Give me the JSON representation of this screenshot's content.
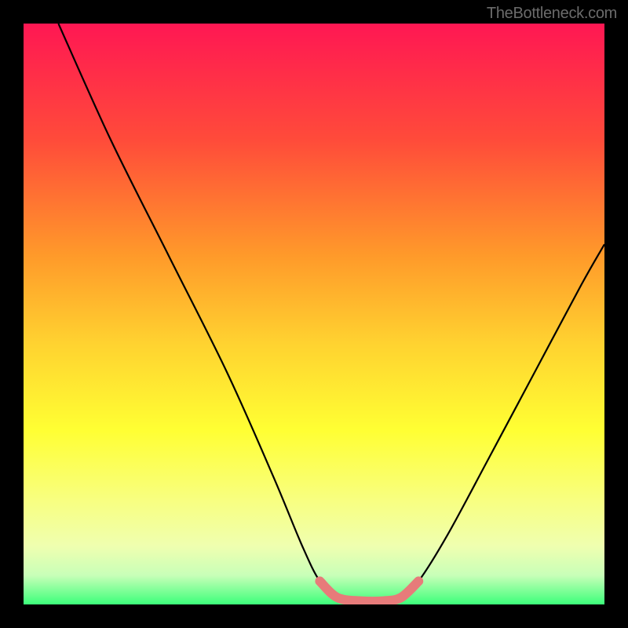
{
  "watermark": "TheBottleneck.com",
  "chart_data": {
    "type": "line",
    "title": "",
    "xlabel": "",
    "ylabel": "",
    "xlim": [
      0,
      100
    ],
    "ylim": [
      0,
      100
    ],
    "gradient_stops": [
      {
        "offset": 0,
        "color": "#ff1753"
      },
      {
        "offset": 20,
        "color": "#ff4b3a"
      },
      {
        "offset": 40,
        "color": "#ff9a2a"
      },
      {
        "offset": 55,
        "color": "#ffd230"
      },
      {
        "offset": 70,
        "color": "#ffff33"
      },
      {
        "offset": 82,
        "color": "#f8ff80"
      },
      {
        "offset": 90,
        "color": "#efffb0"
      },
      {
        "offset": 95,
        "color": "#c8ffb8"
      },
      {
        "offset": 100,
        "color": "#3cff7a"
      }
    ],
    "series": [
      {
        "name": "bottleneck-curve",
        "color": "#000000",
        "points": [
          {
            "x": 6,
            "y": 100
          },
          {
            "x": 15,
            "y": 80
          },
          {
            "x": 25,
            "y": 60
          },
          {
            "x": 35,
            "y": 40
          },
          {
            "x": 43,
            "y": 22
          },
          {
            "x": 48,
            "y": 10
          },
          {
            "x": 51,
            "y": 4
          },
          {
            "x": 54,
            "y": 1.2
          },
          {
            "x": 58,
            "y": 0.6
          },
          {
            "x": 62,
            "y": 0.6
          },
          {
            "x": 65,
            "y": 1.2
          },
          {
            "x": 68,
            "y": 4
          },
          {
            "x": 73,
            "y": 12
          },
          {
            "x": 80,
            "y": 25
          },
          {
            "x": 88,
            "y": 40
          },
          {
            "x": 96,
            "y": 55
          },
          {
            "x": 100,
            "y": 62
          }
        ]
      },
      {
        "name": "highlight-band",
        "color": "#e77b7a",
        "points": [
          {
            "x": 51,
            "y": 4
          },
          {
            "x": 54,
            "y": 1.2
          },
          {
            "x": 58,
            "y": 0.6
          },
          {
            "x": 62,
            "y": 0.6
          },
          {
            "x": 65,
            "y": 1.2
          },
          {
            "x": 68,
            "y": 4
          }
        ]
      }
    ]
  }
}
